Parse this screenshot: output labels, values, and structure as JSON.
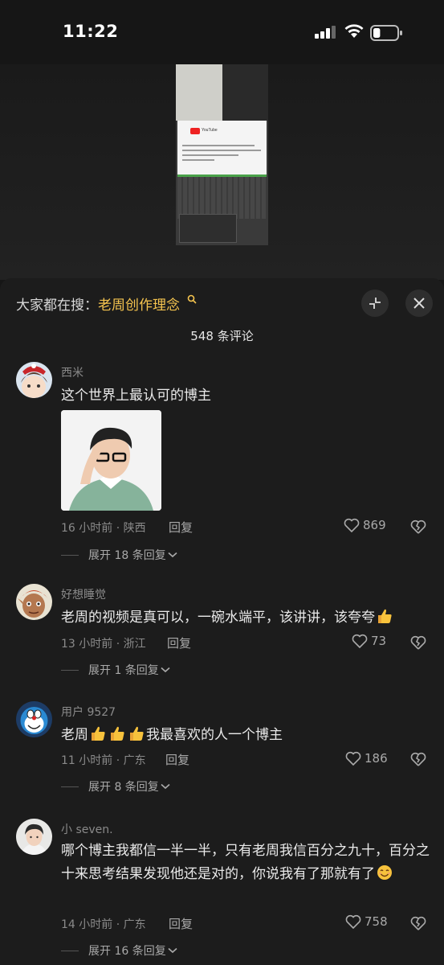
{
  "status_bar": {
    "time": "11:22",
    "battery_level": 0.3
  },
  "video": {
    "thumbnail_text": "YouTube"
  },
  "panel": {
    "search_prefix": "大家都在搜：",
    "search_keyword": "老周创作理念",
    "comment_count": "548 条评论"
  },
  "comments": [
    {
      "user": "西米",
      "text": "这个世界上最认可的博主",
      "meta": "16 小时前 · 陕西",
      "reply": "回复",
      "likes": "869",
      "expand": "展开 18 条回复"
    },
    {
      "user": "好想睡觉",
      "text": "老周的视频是真可以，一碗水端平，该讲讲，该夸夸",
      "meta": "13 小时前 · 浙江",
      "reply": "回复",
      "likes": "73",
      "expand": "展开 1 条回复"
    },
    {
      "user": "用户 9527",
      "text_a": "老周",
      "text_b": "我最喜欢的人一个博主",
      "meta": "11 小时前 · 广东",
      "reply": "回复",
      "likes": "186",
      "expand": "展开 8 条回复"
    },
    {
      "user": "小 seven.",
      "text": "哪个博主我都信一半一半，只有老周我信百分之九十，百分之十来思考结果发现他还是对的，你说我有了那就有了",
      "meta": "14 小时前 · 广东",
      "reply": "回复",
      "likes": "758",
      "expand": "展开 16 条回复"
    }
  ],
  "colors": {
    "accent": "#f5c44f",
    "panel_bg": "#1c1c1c",
    "muted_text": "#8a8a8a"
  },
  "icons": [
    "signal-icon",
    "wifi-icon",
    "battery-icon",
    "search-icon",
    "collapse-icon",
    "close-icon",
    "heart-icon",
    "broken-heart-icon",
    "chevron-down-icon",
    "thumbs-up-emoji",
    "smile-emoji"
  ]
}
